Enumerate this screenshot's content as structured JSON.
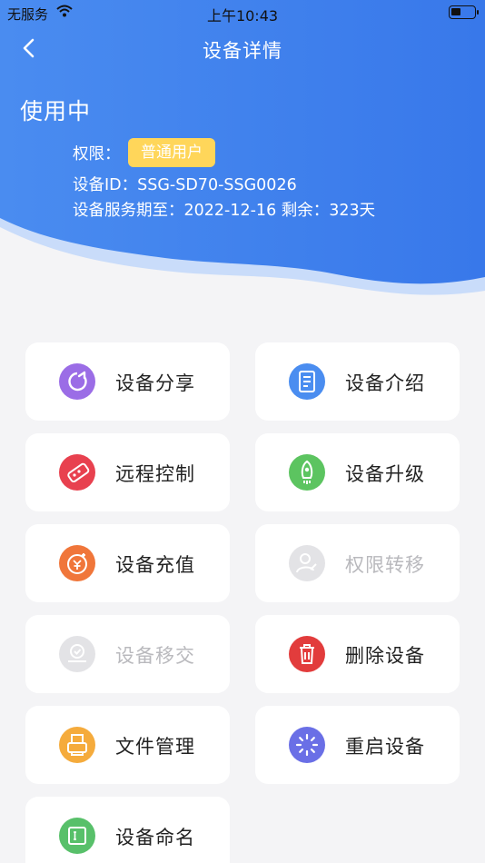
{
  "status_bar": {
    "carrier": "无服务",
    "time": "上午10:43"
  },
  "nav": {
    "title": "设备详情"
  },
  "device": {
    "state": "使用中",
    "permission_label": "权限：",
    "permission_value": "普通用户",
    "id_line": "设备ID：SSG-SD70-SSG0026",
    "expire_line": "设备服务期至：2022-12-16 剩余：323天"
  },
  "actions": [
    {
      "label": "设备分享",
      "icon": "share-icon",
      "color": "#9b6de6",
      "enabled": true
    },
    {
      "label": "设备介绍",
      "icon": "document-icon",
      "color": "#4a8df0",
      "enabled": true
    },
    {
      "label": "远程控制",
      "icon": "remote-control-icon",
      "color": "#e8414f",
      "enabled": true
    },
    {
      "label": "设备升级",
      "icon": "rocket-icon",
      "color": "#5cc460",
      "enabled": true
    },
    {
      "label": "设备充值",
      "icon": "recharge-icon",
      "color": "#f0763a",
      "enabled": true
    },
    {
      "label": "权限转移",
      "icon": "user-transfer-icon",
      "color": "#e3e3e6",
      "enabled": false
    },
    {
      "label": "设备移交",
      "icon": "handover-icon",
      "color": "#e3e3e6",
      "enabled": false
    },
    {
      "label": "删除设备",
      "icon": "trash-icon",
      "color": "#e23c3c",
      "enabled": true
    },
    {
      "label": "文件管理",
      "icon": "printer-icon",
      "color": "#f5ab3c",
      "enabled": true
    },
    {
      "label": "重启设备",
      "icon": "restart-icon",
      "color": "#6a6fe6",
      "enabled": true
    },
    {
      "label": "设备命名",
      "icon": "rename-icon",
      "color": "#58c06a",
      "enabled": true
    }
  ],
  "colors": {
    "header_blue": "#3f82ee",
    "badge_yellow": "#ffd65a",
    "background": "#f4f4f6"
  }
}
